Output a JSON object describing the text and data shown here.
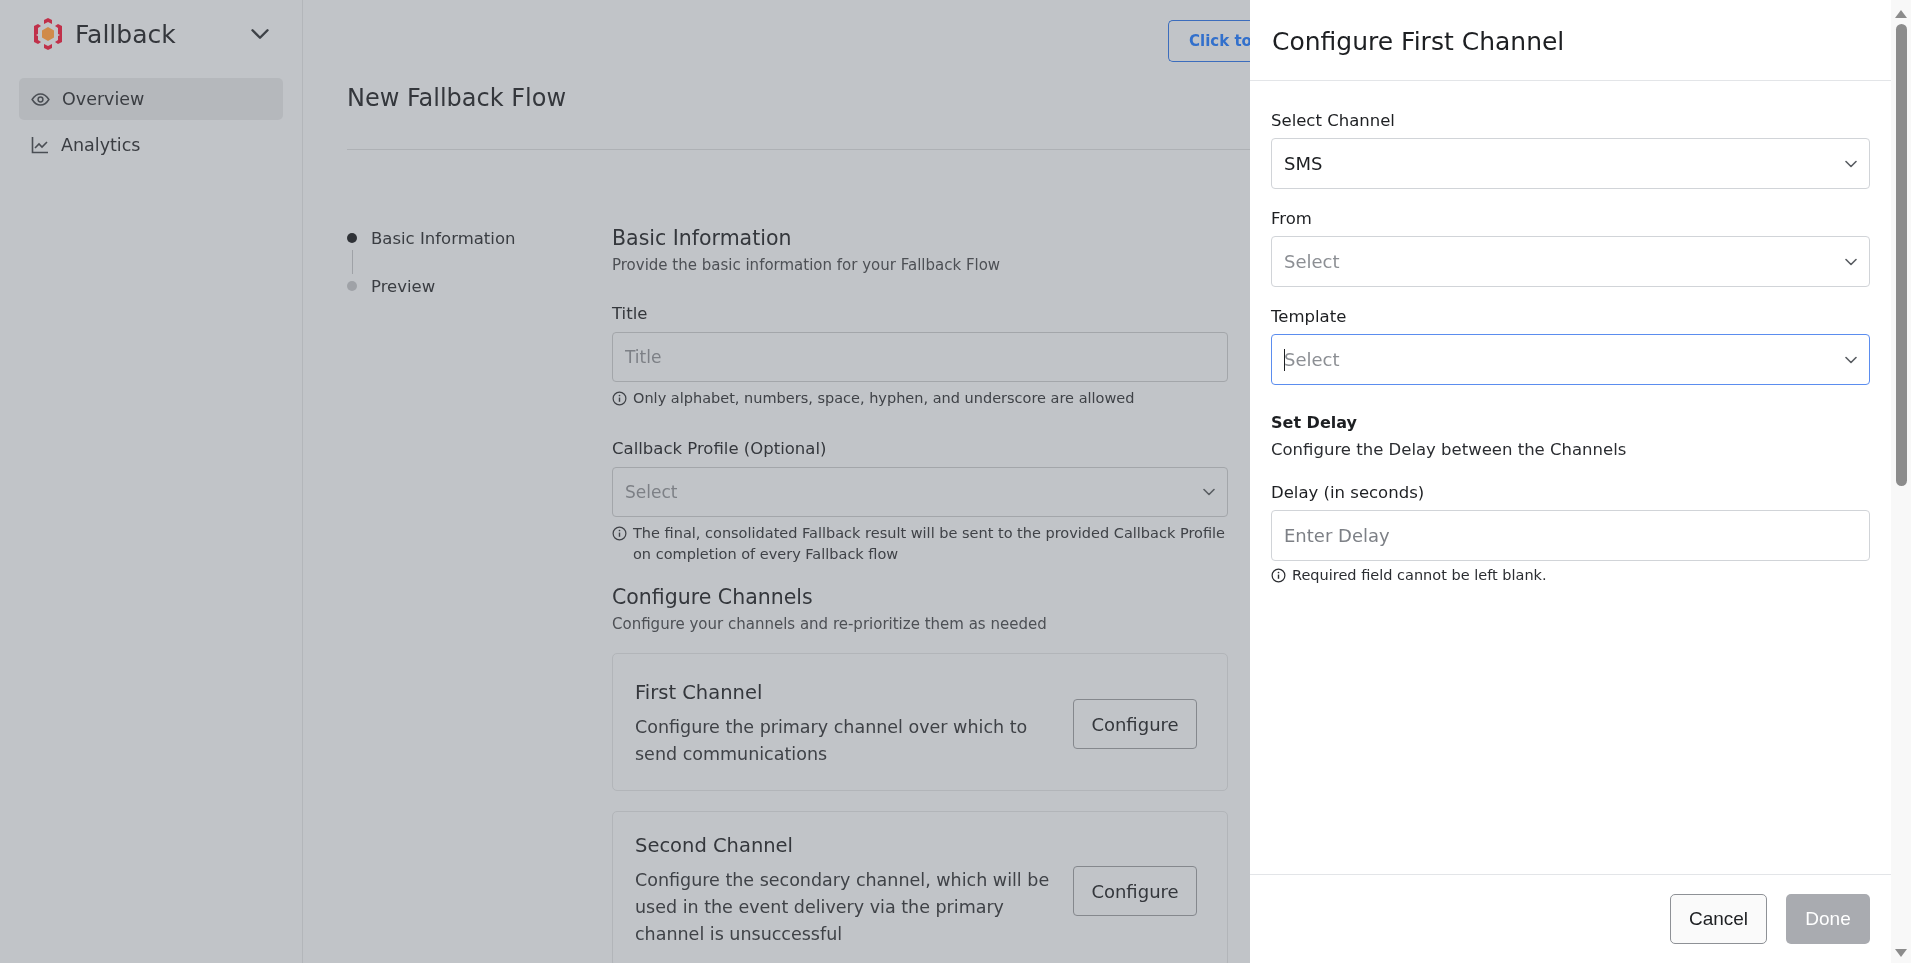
{
  "sidebar": {
    "app_name": "Fallback",
    "items": [
      {
        "label": "Overview",
        "kind": "eye",
        "selected": true
      },
      {
        "label": "Analytics",
        "kind": "chart",
        "selected": false
      }
    ]
  },
  "header": {
    "title": "New Fallback Flow",
    "action_button": "Click to"
  },
  "steps": [
    {
      "label": "Basic Information",
      "active": true
    },
    {
      "label": "Preview",
      "active": false
    }
  ],
  "basic_info": {
    "heading": "Basic Information",
    "subtitle": "Provide the basic information for your Fallback Flow",
    "fields": [
      {
        "label": "Title",
        "kind": "input",
        "placeholder": "Title",
        "hint": "Only alphabet, numbers, space, hyphen, and underscore are allowed"
      },
      {
        "label": "Callback Profile (Optional)",
        "kind": "select",
        "placeholder": "Select",
        "hint": "The final, consolidated Fallback result will be sent to the provided Callback Profile on completion of every Fallback flow"
      }
    ]
  },
  "channels": {
    "heading": "Configure Channels",
    "subtitle": "Configure your channels and re-prioritize them as needed",
    "cards": [
      {
        "title": "First Channel",
        "description": "Configure the primary channel over which to send communications",
        "button": "Configure"
      },
      {
        "title": "Second Channel",
        "description": "Configure the secondary channel, which will be used in the event delivery via the primary channel is unsuccessful",
        "button": "Configure"
      }
    ]
  },
  "drawer": {
    "title": "Configure First Channel",
    "fields": [
      {
        "label": "Select Channel",
        "kind": "select",
        "value": "SMS",
        "focused": false
      },
      {
        "label": "From",
        "kind": "select",
        "placeholder": "Select",
        "focused": false
      },
      {
        "label": "Template",
        "kind": "select",
        "placeholder": "Select",
        "focused": true
      }
    ],
    "delay_section": {
      "heading": "Set Delay",
      "description": "Configure the Delay between the Channels"
    },
    "delay_field": {
      "label": "Delay (in seconds)",
      "kind": "input",
      "placeholder": "Enter Delay",
      "hint": "Required field cannot be left blank."
    },
    "buttons": [
      {
        "label": "Cancel",
        "disabled": false
      },
      {
        "label": "Done",
        "disabled": true
      }
    ]
  }
}
